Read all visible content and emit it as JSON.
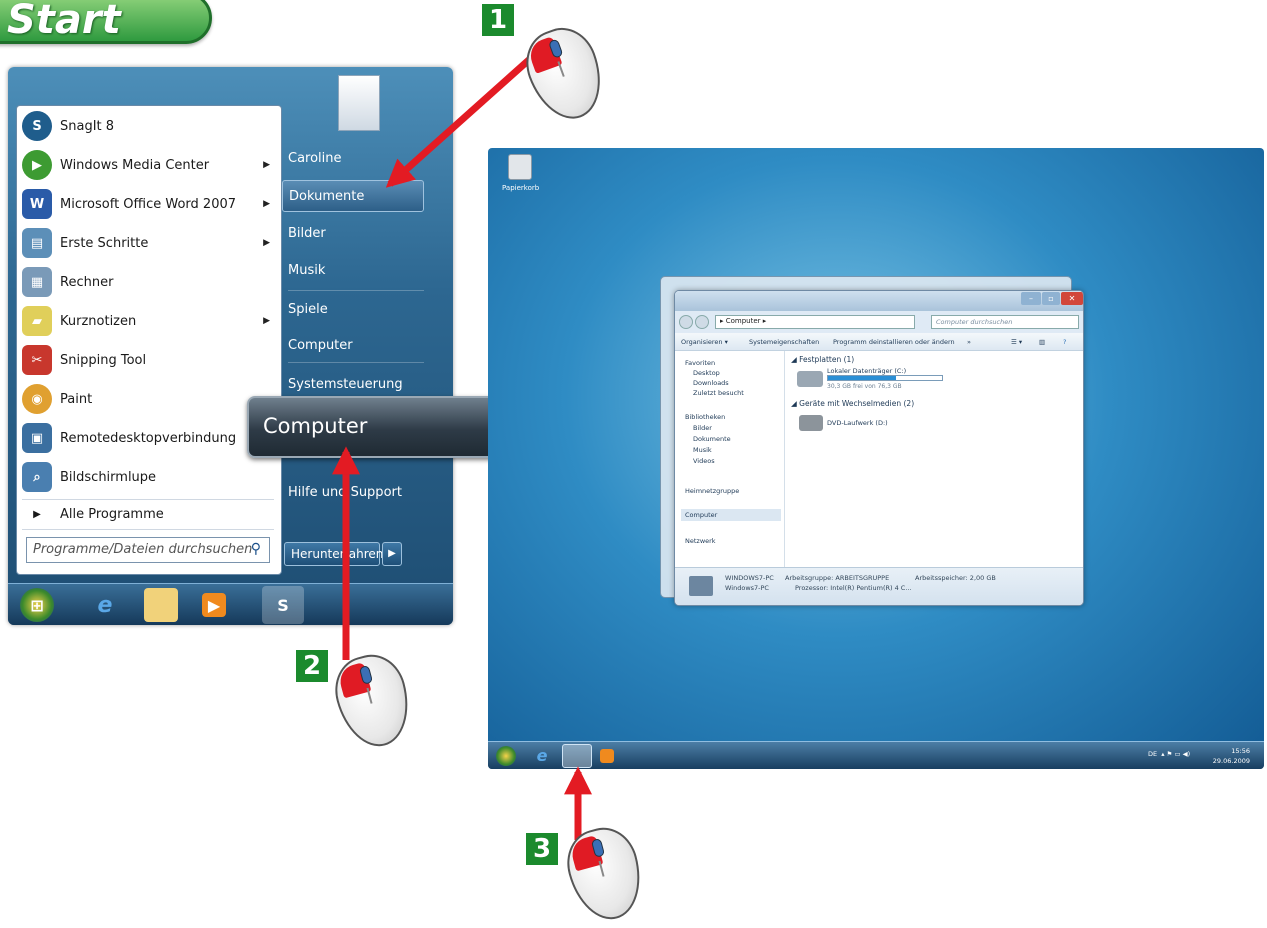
{
  "badge": {
    "start": "Start"
  },
  "steps": [
    "1",
    "2",
    "3"
  ],
  "start_menu": {
    "left_items": [
      {
        "label": "SnagIt 8",
        "icon": "snagit-icon",
        "color": "#1f5d8c",
        "submenu": false
      },
      {
        "label": "Windows Media Center",
        "icon": "media-center-icon",
        "color": "#3d9b32",
        "submenu": true
      },
      {
        "label": "Microsoft Office Word 2007",
        "icon": "word-icon",
        "color": "#2a5ba8",
        "submenu": true
      },
      {
        "label": "Erste Schritte",
        "icon": "getting-started-icon",
        "color": "#5c8fb8",
        "submenu": true
      },
      {
        "label": "Rechner",
        "icon": "calculator-icon",
        "color": "#7a9ab8",
        "submenu": false
      },
      {
        "label": "Kurznotizen",
        "icon": "sticky-notes-icon",
        "color": "#e0cf5a",
        "submenu": true
      },
      {
        "label": "Snipping Tool",
        "icon": "scissors-icon",
        "color": "#c8372d",
        "submenu": false
      },
      {
        "label": "Paint",
        "icon": "paint-palette-icon",
        "color": "#e0a030",
        "submenu": false
      },
      {
        "label": "Remotedesktopverbindung",
        "icon": "remote-desktop-icon",
        "color": "#3b6fa0",
        "submenu": false
      },
      {
        "label": "Bildschirmlupe",
        "icon": "magnifier-icon",
        "color": "#4a7fb0",
        "submenu": false
      }
    ],
    "all_programs": "Alle Programme",
    "search_placeholder": "Programme/Dateien durchsuchen",
    "right_items": [
      "Caroline",
      "Dokumente",
      "Bilder",
      "Musik",
      "Spiele",
      "Computer",
      "Systemsteuerung",
      "Hilfe und Support"
    ],
    "highlighted": "Dokumente",
    "shutdown": "Herunterfahren"
  },
  "tooltip": "Computer",
  "desktop": {
    "recycle_label": "Papierkorb",
    "window": {
      "breadcrumb": "▸ Computer ▸",
      "search_placeholder": "Computer durchsuchen",
      "toolbar": [
        "Organisieren ▾",
        "Systemeigenschaften",
        "Programm deinstallieren oder ändern",
        "»"
      ],
      "nav": [
        "Favoriten",
        "Desktop",
        "Downloads",
        "Zuletzt besucht",
        "Bibliotheken",
        "Bilder",
        "Dokumente",
        "Musik",
        "Videos",
        "Heimnetzgruppe",
        "Computer",
        "Netzwerk"
      ],
      "group1": "◢ Festplatten (1)",
      "drive_c": "Lokaler Datenträger (C:)",
      "drive_c_free": "30,3 GB frei von 76,3 GB",
      "drive_c_used_fraction": 0.6,
      "group2": "◢ Geräte mit Wechselmedien (2)",
      "drive_d": "DVD-Laufwerk (D:)",
      "status_name": "WINDOWS7-PC",
      "status_sub": "Windows7-PC",
      "status_workgroup": "Arbeitsgruppe: ARBEITSGRUPPE",
      "status_memory": "Arbeitsspeicher: 2,00 GB",
      "status_cpu": "Prozessor: Intel(R) Pentium(R) 4 C..."
    },
    "tray_lang": "DE",
    "clock_time": "15:56",
    "clock_date": "29.06.2009"
  }
}
